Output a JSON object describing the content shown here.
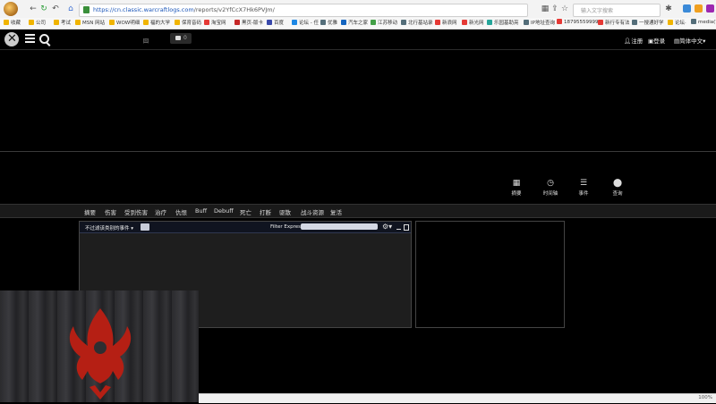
{
  "browser": {
    "url_host": "https://cn.classic.warcraftlogs.com",
    "url_path": "/reports/v2YfCcX7Hk6PVJm/",
    "search_placeholder": "输入文字搜索",
    "zoom": "100%",
    "bookmarks": [
      {
        "label": "收藏",
        "color": "#f0b400"
      },
      {
        "label": "公司",
        "color": "#f0b400"
      },
      {
        "label": "考试",
        "color": "#f0b400"
      },
      {
        "label": "MSN 网站",
        "color": "#f0b400"
      },
      {
        "label": "WOW明细",
        "color": "#f0b400"
      },
      {
        "label": "福的大学",
        "color": "#f0b400"
      },
      {
        "label": "保育音码",
        "color": "#f0b400"
      },
      {
        "label": "淘宝网",
        "color": "#e53935"
      },
      {
        "label": "黑页-版卡",
        "color": "#c62828"
      },
      {
        "label": "百度",
        "color": "#3949ab"
      },
      {
        "label": "论坛 - 任",
        "color": "#1e88e5"
      },
      {
        "label": "优雅",
        "color": "#546e7a"
      },
      {
        "label": "汽车之家",
        "color": "#1565c0"
      },
      {
        "label": "江苏移动",
        "color": "#43a047"
      },
      {
        "label": "北行基站录",
        "color": "#546e7a"
      },
      {
        "label": "新浪网",
        "color": "#e53935"
      },
      {
        "label": "新光网",
        "color": "#e53935"
      },
      {
        "label": "乐园基助亮",
        "color": "#26a69a"
      },
      {
        "label": "IP地址查询",
        "color": "#546e7a"
      },
      {
        "label": "18795559999",
        "color": "#e53935"
      },
      {
        "label": "新行专有法",
        "color": "#e53935"
      },
      {
        "label": "一搜通好学",
        "color": "#546e7a"
      },
      {
        "label": "论坛·",
        "color": "#f0b400"
      },
      {
        "label": "media(7/",
        "color": "#546e7a"
      }
    ]
  },
  "site_nav": {
    "square_label": "囧",
    "messages_count": "0",
    "register": "注册",
    "login": "登录",
    "language": "简体中文"
  },
  "view_buttons": [
    {
      "icon": "grid-icon",
      "glyph": "▦",
      "label": "摘要"
    },
    {
      "icon": "clock-icon",
      "glyph": "◷",
      "label": "时间轴"
    },
    {
      "icon": "list-icon",
      "glyph": "☰",
      "label": "事件"
    },
    {
      "icon": "map-pin-icon",
      "glyph": "⬤",
      "label": "查询"
    }
  ],
  "tabs": [
    "摘要",
    "伤害",
    "受到伤害",
    "治疗",
    "仇恨",
    "Buff",
    "Debuff",
    "死亡",
    "打断",
    "驱散",
    "战斗资源",
    "复活"
  ],
  "events_panel": {
    "filter_label": "不过滤该类别的事件",
    "filter_expression_label": "Filter Expression:",
    "filter_expression_value": ""
  },
  "colors": {
    "horde_red": "#b51f14",
    "page_bg": "#000000",
    "panel_bg": "#1e1e1e"
  }
}
